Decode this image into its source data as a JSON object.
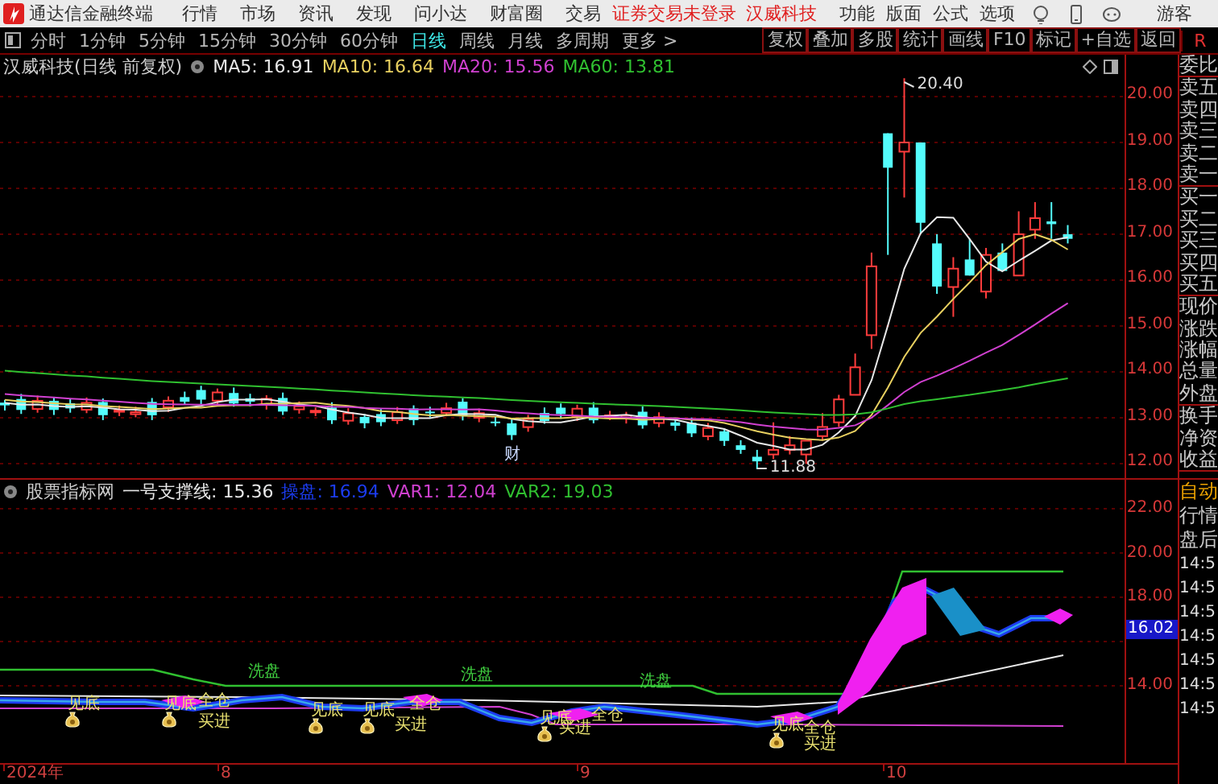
{
  "title_bar": {
    "app_name": "通达信金融终端",
    "menu": [
      "行情",
      "市场",
      "资讯",
      "发现",
      "问小达",
      "财富圈",
      "交易"
    ],
    "login_notice": "证券交易未登录",
    "stock_name": "汉威科技",
    "right_menu": [
      "功能",
      "版面",
      "公式",
      "选项"
    ],
    "user": "游客"
  },
  "period_tabs": [
    {
      "label": "分时",
      "selected": false
    },
    {
      "label": "1分钟",
      "selected": false
    },
    {
      "label": "5分钟",
      "selected": false
    },
    {
      "label": "15分钟",
      "selected": false
    },
    {
      "label": "30分钟",
      "selected": false
    },
    {
      "label": "60分钟",
      "selected": false
    },
    {
      "label": "日线",
      "selected": true
    },
    {
      "label": "周线",
      "selected": false
    },
    {
      "label": "月线",
      "selected": false
    },
    {
      "label": "多周期",
      "selected": false
    },
    {
      "label": "更多 >",
      "selected": false
    }
  ],
  "chart_tools": [
    "复权",
    "叠加",
    "多股",
    "统计",
    "画线",
    "F10",
    "标记",
    "+自选",
    "返回"
  ],
  "corner_label": "R",
  "main_chart": {
    "title": "汉威科技(日线 前复权)",
    "indicators": [
      {
        "text": "MA5: 16.91",
        "color": "#e8e8e8"
      },
      {
        "text": "MA10: 16.64",
        "color": "#e8d060"
      },
      {
        "text": "MA20: 15.56",
        "color": "#d040d0"
      },
      {
        "text": "MA60: 13.81",
        "color": "#30c030"
      }
    ],
    "high_label": "20.40",
    "low_label": "11.88",
    "event_marker": "财",
    "price_ticks": [
      "20.00",
      "19.00",
      "18.00",
      "17.00",
      "16.00",
      "15.00",
      "14.00",
      "13.00",
      "12.00"
    ]
  },
  "indicator_chart": {
    "title": "股票指标网",
    "readouts": [
      {
        "text": "一号支撑线: 15.36",
        "color": "#e8e8e8"
      },
      {
        "text": "操盘: 16.94",
        "color": "#1c3cf0"
      },
      {
        "text": "VAR1: 12.04",
        "color": "#d040d0"
      },
      {
        "text": "VAR2: 19.03",
        "color": "#30c030"
      }
    ],
    "signals": [
      {
        "kind": "bottom",
        "text": "见底"
      },
      {
        "kind": "bottom",
        "text": "见底"
      },
      {
        "kind": "full",
        "text": "全仓"
      },
      {
        "kind": "buy",
        "text": "买进"
      },
      {
        "kind": "wash",
        "text": "洗盘"
      },
      {
        "kind": "bottom",
        "text": "见底"
      },
      {
        "kind": "bottom",
        "text": "见底"
      },
      {
        "kind": "full",
        "text": "全仓"
      },
      {
        "kind": "buy",
        "text": "买进"
      },
      {
        "kind": "wash",
        "text": "洗盘"
      },
      {
        "kind": "bottom",
        "text": "见底"
      },
      {
        "kind": "buy",
        "text": "买进"
      },
      {
        "kind": "full",
        "text": "全仓"
      },
      {
        "kind": "wash",
        "text": "洗盘"
      },
      {
        "kind": "bottom",
        "text": "见底"
      },
      {
        "kind": "full",
        "text": "全仓"
      },
      {
        "kind": "buy",
        "text": "买进"
      }
    ],
    "price_ticks": [
      "22.00",
      "20.00",
      "18.00",
      "14.00"
    ],
    "current_value": "16.02"
  },
  "date_axis": [
    "2024年",
    "8",
    "9",
    "10"
  ],
  "quote_panel": {
    "groups": [
      {
        "labels": [
          "委比"
        ]
      },
      {
        "labels": [
          "卖五",
          "卖四",
          "卖三",
          "卖二",
          "卖一"
        ]
      },
      {
        "labels": [
          "买一",
          "买二",
          "买三",
          "买四",
          "买五"
        ]
      },
      {
        "labels": [
          "现价",
          "涨跌",
          "涨幅",
          "总量",
          "外盘"
        ]
      },
      {
        "labels": [
          "换手",
          "净资",
          "收益"
        ]
      }
    ],
    "feed_tabs": [
      {
        "label": "自动",
        "selected": true
      },
      {
        "label": "行情",
        "selected": false
      },
      {
        "label": "盘后",
        "selected": false
      }
    ],
    "tick_times": [
      "14:5",
      "14:5",
      "14:5",
      "14:5",
      "14:5",
      "14:5",
      "14:5"
    ]
  }
}
